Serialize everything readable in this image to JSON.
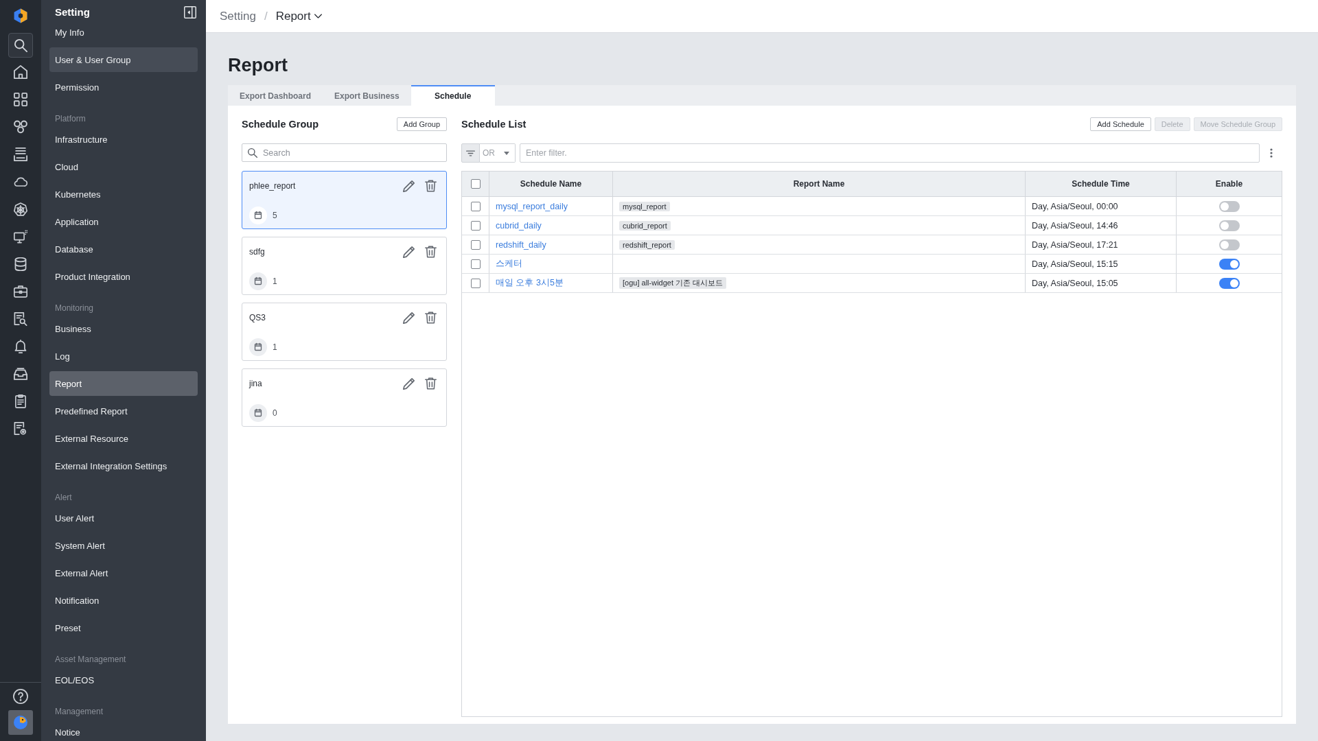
{
  "sidebar": {
    "title": "Setting",
    "sections": [
      {
        "items": [
          {
            "label": "My Info",
            "selected": false,
            "hovered": false
          },
          {
            "label": "User & User Group",
            "selected": false,
            "hovered": true
          },
          {
            "label": "Permission",
            "selected": false,
            "hovered": false
          }
        ]
      },
      {
        "heading": "Platform",
        "items": [
          {
            "label": "Infrastructure",
            "selected": false,
            "hovered": false
          },
          {
            "label": "Cloud",
            "selected": false,
            "hovered": false
          },
          {
            "label": "Kubernetes",
            "selected": false,
            "hovered": false
          },
          {
            "label": "Application",
            "selected": false,
            "hovered": false
          },
          {
            "label": "Database",
            "selected": false,
            "hovered": false
          },
          {
            "label": "Product Integration",
            "selected": false,
            "hovered": false
          }
        ]
      },
      {
        "heading": "Monitoring",
        "items": [
          {
            "label": "Business",
            "selected": false,
            "hovered": false
          },
          {
            "label": "Log",
            "selected": false,
            "hovered": false
          },
          {
            "label": "Report",
            "selected": true,
            "hovered": false
          },
          {
            "label": "Predefined Report",
            "selected": false,
            "hovered": false
          },
          {
            "label": "External Resource",
            "selected": false,
            "hovered": false
          },
          {
            "label": "External Integration Settings",
            "selected": false,
            "hovered": false
          }
        ]
      },
      {
        "heading": "Alert",
        "items": [
          {
            "label": "User Alert",
            "selected": false,
            "hovered": false
          },
          {
            "label": "System Alert",
            "selected": false,
            "hovered": false
          },
          {
            "label": "External Alert",
            "selected": false,
            "hovered": false
          },
          {
            "label": "Notification",
            "selected": false,
            "hovered": false
          },
          {
            "label": "Preset",
            "selected": false,
            "hovered": false
          }
        ]
      },
      {
        "heading": "Asset Management",
        "items": [
          {
            "label": "EOL/EOS",
            "selected": false,
            "hovered": false
          }
        ]
      },
      {
        "heading": "Management",
        "items": [
          {
            "label": "Notice",
            "selected": false,
            "hovered": false
          }
        ]
      }
    ]
  },
  "breadcrumb": {
    "items": [
      "Setting"
    ],
    "separator": "/",
    "current": "Report"
  },
  "page_title": "Report",
  "tabs": [
    {
      "label": "Export Dashboard",
      "selected": false
    },
    {
      "label": "Export Business",
      "selected": false
    },
    {
      "label": "Schedule",
      "selected": true
    }
  ],
  "schedule_group": {
    "title": "Schedule Group",
    "add_button": "Add Group",
    "search": {
      "placeholder": "Search"
    },
    "groups": [
      {
        "name": "phlee_report",
        "count": "5",
        "selected": true
      },
      {
        "name": "sdfg",
        "count": "1",
        "selected": false
      },
      {
        "name": "QS3",
        "count": "1",
        "selected": false
      },
      {
        "name": "jina",
        "count": "0",
        "selected": false
      }
    ]
  },
  "schedule_list": {
    "title": "Schedule List",
    "buttons": [
      {
        "label": "Add Schedule",
        "disabled": false
      },
      {
        "label": "Delete",
        "disabled": true
      },
      {
        "label": "Move Schedule Group",
        "disabled": true
      }
    ],
    "filter": {
      "operator": "OR",
      "placeholder": "Enter filter."
    },
    "table": {
      "header_checked": false,
      "columns": [
        "Schedule Name",
        "Report Name",
        "Schedule Time",
        "Enable"
      ],
      "rows": [
        {
          "checked": false,
          "schedule_name": "mysql_report_daily",
          "report_name": "mysql_report",
          "schedule_time": "Day, Asia/Seoul, 00:00",
          "enabled": false
        },
        {
          "checked": false,
          "schedule_name": "cubrid_daily",
          "report_name": "cubrid_report",
          "schedule_time": "Day, Asia/Seoul, 14:46",
          "enabled": false
        },
        {
          "checked": false,
          "schedule_name": "redshift_daily",
          "report_name": "redshift_report",
          "schedule_time": "Day, Asia/Seoul, 17:21",
          "enabled": false
        },
        {
          "checked": false,
          "schedule_name": "스케터",
          "schedule_time": "Day, Asia/Seoul, 15:15",
          "enabled": true
        },
        {
          "checked": false,
          "schedule_name": "매일 오후 3시5분",
          "report_name": "[ogu] all-widget 기존 대시보드",
          "schedule_time": "Day, Asia/Seoul, 15:05",
          "enabled": true
        }
      ]
    }
  }
}
